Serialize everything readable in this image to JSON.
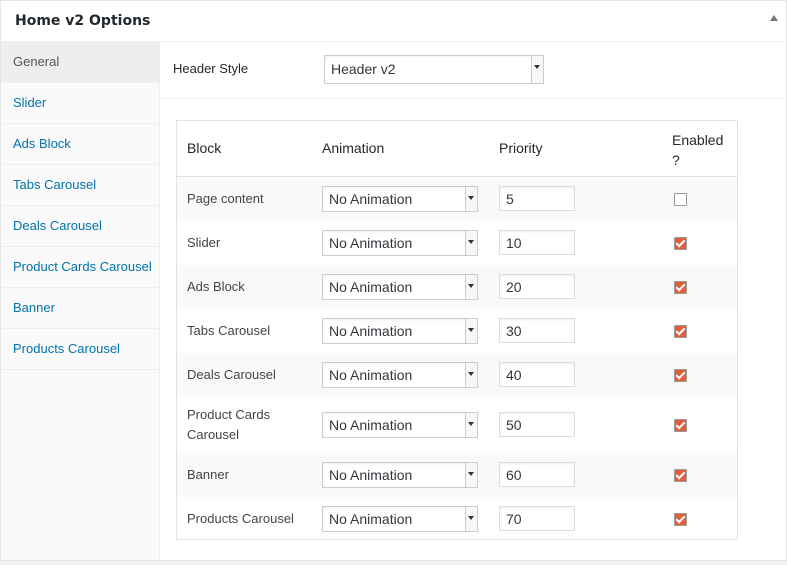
{
  "panel": {
    "title": "Home v2 Options"
  },
  "sidebar": {
    "items": [
      {
        "label": "General",
        "active": true
      },
      {
        "label": "Slider"
      },
      {
        "label": "Ads Block"
      },
      {
        "label": "Tabs Carousel"
      },
      {
        "label": "Deals Carousel"
      },
      {
        "label": "Product Cards Carousel"
      },
      {
        "label": "Banner"
      },
      {
        "label": "Products Carousel"
      }
    ]
  },
  "header_style": {
    "label": "Header Style",
    "value": "Header v2"
  },
  "table": {
    "columns": [
      "Block",
      "Animation",
      "Priority",
      "Enabled",
      "?"
    ],
    "rows": [
      {
        "block": "Page content",
        "animation": "No Animation",
        "priority": "5",
        "enabled": false
      },
      {
        "block": "Slider",
        "animation": "No Animation",
        "priority": "10",
        "enabled": true
      },
      {
        "block": "Ads Block",
        "animation": "No Animation",
        "priority": "20",
        "enabled": true
      },
      {
        "block": "Tabs Carousel",
        "animation": "No Animation",
        "priority": "30",
        "enabled": true
      },
      {
        "block": "Deals Carousel",
        "animation": "No Animation",
        "priority": "40",
        "enabled": true
      },
      {
        "block": "Product Cards",
        "block_line2": "Carousel",
        "animation": "No Animation",
        "priority": "50",
        "enabled": true
      },
      {
        "block": "Banner",
        "animation": "No Animation",
        "priority": "60",
        "enabled": true
      },
      {
        "block": "Products Carousel",
        "animation": "No Animation",
        "priority": "70",
        "enabled": true
      }
    ]
  },
  "colors": {
    "link": "#0073aa",
    "checkbox_checked": "#e25f3c"
  }
}
